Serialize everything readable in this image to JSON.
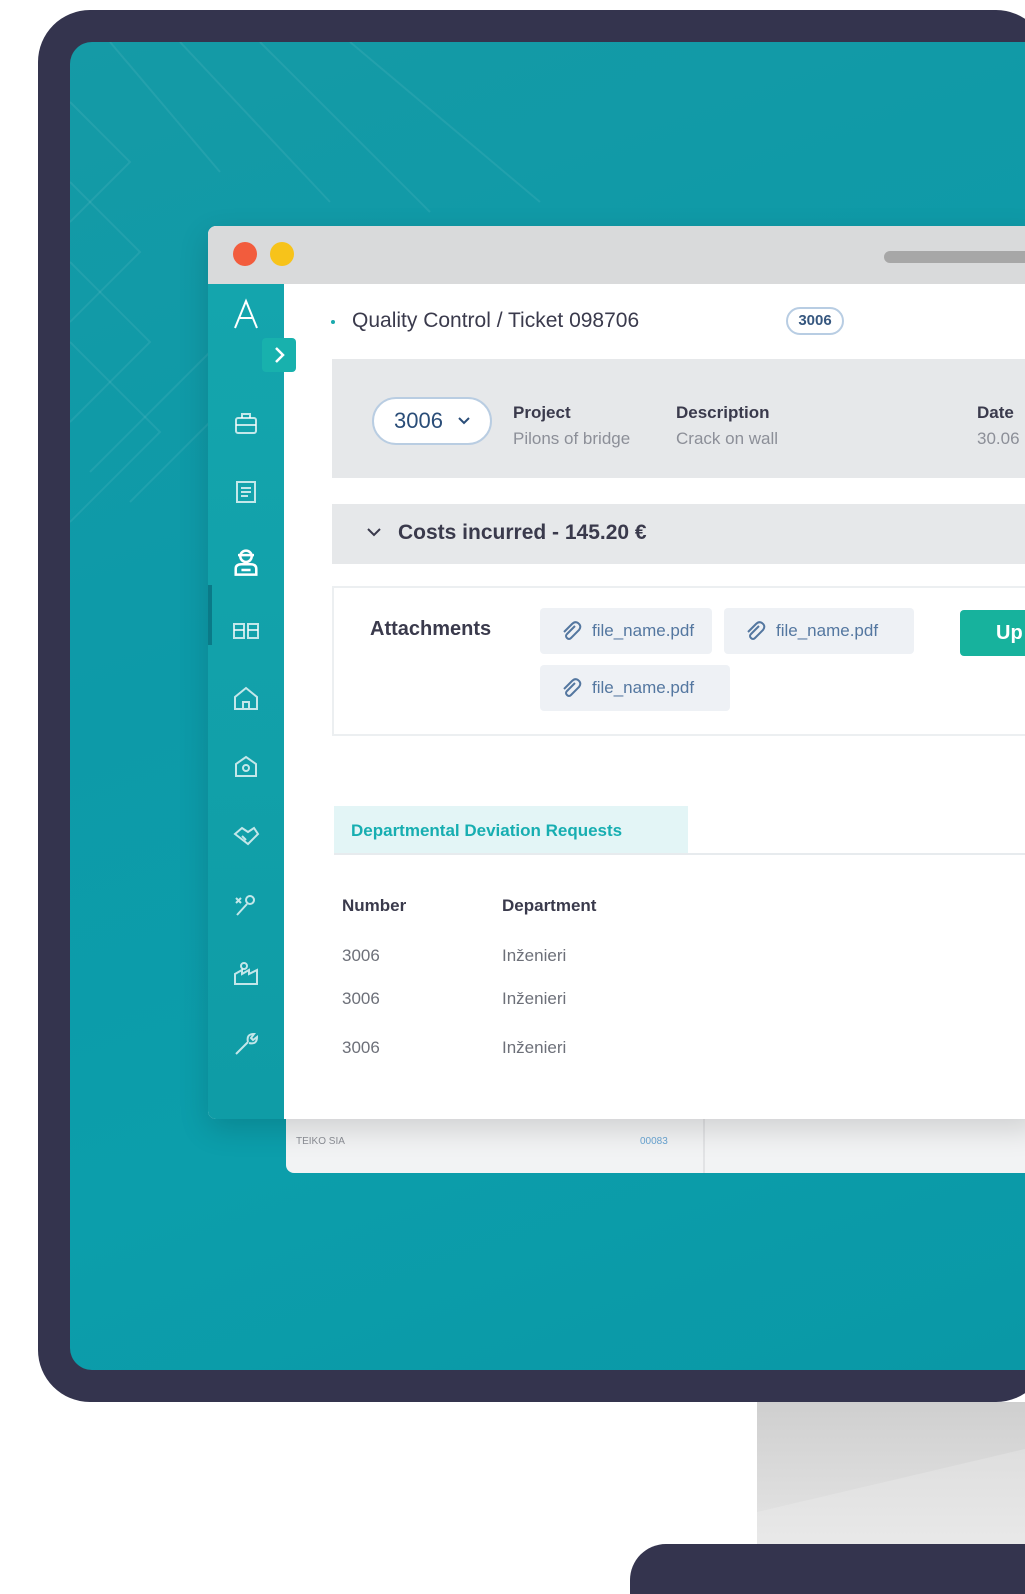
{
  "window": {
    "breadcrumb": "Quality Control / Ticket 098706",
    "ticket_badge": "3006"
  },
  "info": {
    "selected_number": "3006",
    "project_label": "Project",
    "project_value": "Pilons of bridge",
    "description_label": "Description",
    "description_value": "Crack on wall",
    "date_label": "Date",
    "date_value": "30.06"
  },
  "costs": {
    "label": "Costs incurred - 145.20 €"
  },
  "attachments": {
    "title": "Attachments",
    "files": [
      "file_name.pdf",
      "file_name.pdf",
      "file_name.pdf"
    ],
    "upload_label": "Up"
  },
  "tabs": {
    "active": "Departmental Deviation Requests"
  },
  "table": {
    "headers": [
      "Number",
      "Department"
    ],
    "rows": [
      [
        "3006",
        "Inženieri"
      ],
      [
        "3006",
        "Inženieri"
      ],
      [
        "3006",
        "Inženieri"
      ]
    ]
  },
  "background_list": {
    "company": "TEIKO SIA",
    "code": "00083"
  },
  "sidebar": {
    "icons": [
      "briefcase-icon",
      "document-icon",
      "inspector-icon",
      "workers-icon",
      "building-icon",
      "settings-building-icon",
      "handshake-icon",
      "tools-icon",
      "factory-icon",
      "wrench-icon"
    ]
  },
  "colors": {
    "accent": "#17b29d",
    "sidebar": "#14a5ad",
    "screen": "#0d9aa8",
    "bezel": "#34344e",
    "link": "#5477a0"
  }
}
